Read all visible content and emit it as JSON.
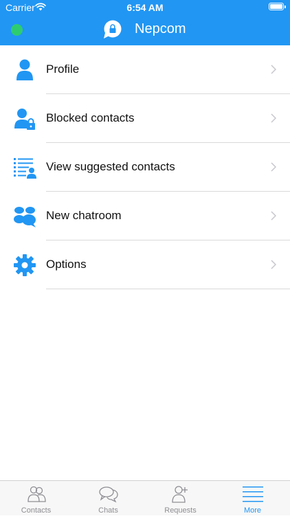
{
  "status_bar": {
    "carrier": "Carrier",
    "time": "6:54 AM"
  },
  "nav": {
    "title": "Nepcom",
    "logo_icon": "chat-lock-icon",
    "presence": "online"
  },
  "menu": [
    {
      "label": "Profile",
      "icon": "user-icon"
    },
    {
      "label": "Blocked contacts",
      "icon": "user-lock-icon"
    },
    {
      "label": "View suggested contacts",
      "icon": "list-user-icon"
    },
    {
      "label": "New chatroom",
      "icon": "group-chat-icon"
    },
    {
      "label": "Options",
      "icon": "gear-icon"
    }
  ],
  "tabbar": [
    {
      "label": "Contacts",
      "icon": "contacts-icon",
      "active": false
    },
    {
      "label": "Chats",
      "icon": "chats-icon",
      "active": false
    },
    {
      "label": "Requests",
      "icon": "add-user-icon",
      "active": false
    },
    {
      "label": "More",
      "icon": "menu-icon",
      "active": true
    }
  ],
  "colors": {
    "primary": "#2196f3",
    "online": "#2ecc71",
    "inactive": "#8e8e93"
  }
}
